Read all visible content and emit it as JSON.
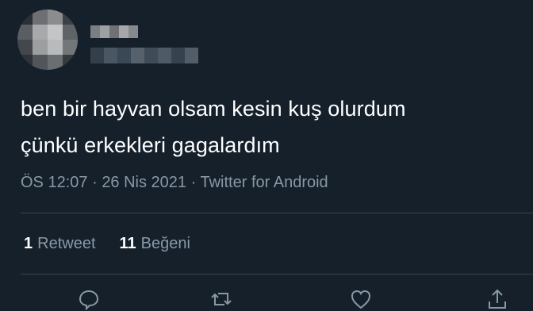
{
  "tweet": {
    "text_lines": [
      "ben bir hayvan olsam kesin kuş olurdum",
      "çünkü erkekleri gagalardım"
    ],
    "time": "ÖS 12:07",
    "date": "26 Nis 2021",
    "source": "Twitter for Android",
    "separator": "·"
  },
  "stats": {
    "retweets_count": "1",
    "retweets_label": "Retweet",
    "likes_count": "11",
    "likes_label": "Beğeni"
  },
  "actions": [
    {
      "icon": "reply-icon"
    },
    {
      "icon": "retweet-icon"
    },
    {
      "icon": "like-icon"
    },
    {
      "icon": "share-icon"
    }
  ],
  "colors": {
    "background": "#15202b",
    "text": "#ffffff",
    "secondary_text": "#8899a6",
    "divider": "#38444d"
  }
}
